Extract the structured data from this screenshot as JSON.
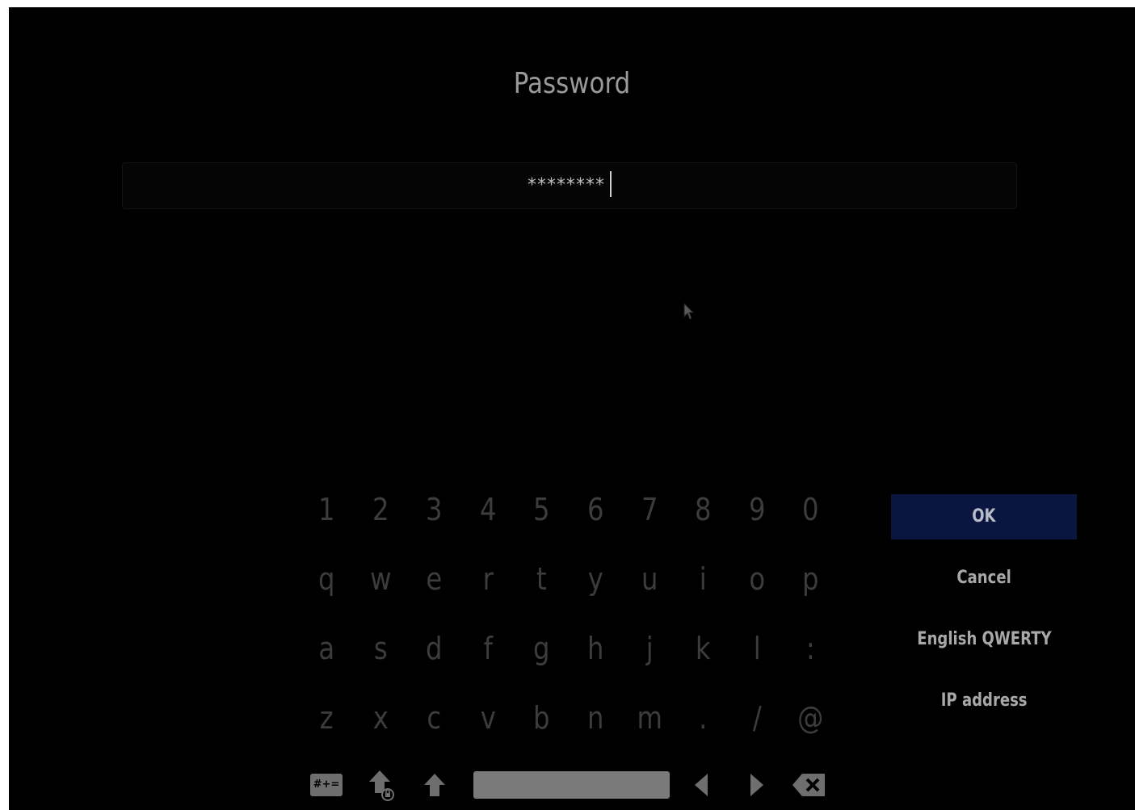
{
  "dialog": {
    "title": "Password",
    "input_value": "********"
  },
  "keyboard": {
    "rows": [
      [
        "1",
        "2",
        "3",
        "4",
        "5",
        "6",
        "7",
        "8",
        "9",
        "0"
      ],
      [
        "q",
        "w",
        "e",
        "r",
        "t",
        "y",
        "u",
        "i",
        "o",
        "p"
      ],
      [
        "a",
        "s",
        "d",
        "f",
        "g",
        "h",
        "j",
        "k",
        "l",
        ":"
      ],
      [
        "z",
        "x",
        "c",
        "v",
        "b",
        "n",
        "m",
        ".",
        "/",
        "@"
      ]
    ],
    "symbols_label": "#+=",
    "tools": [
      "symbols-key-icon",
      "shift-lock-icon",
      "shift-icon",
      "space-bar",
      "left-arrow-icon",
      "right-arrow-icon",
      "backspace-icon"
    ]
  },
  "actions": {
    "ok": "OK",
    "cancel": "Cancel",
    "layout": "English QWERTY",
    "ip": "IP address"
  },
  "colors": {
    "background": "#000000",
    "focus": "#0a1640",
    "key_text": "#3c3c3c",
    "button_text": "#a8a8a8"
  }
}
